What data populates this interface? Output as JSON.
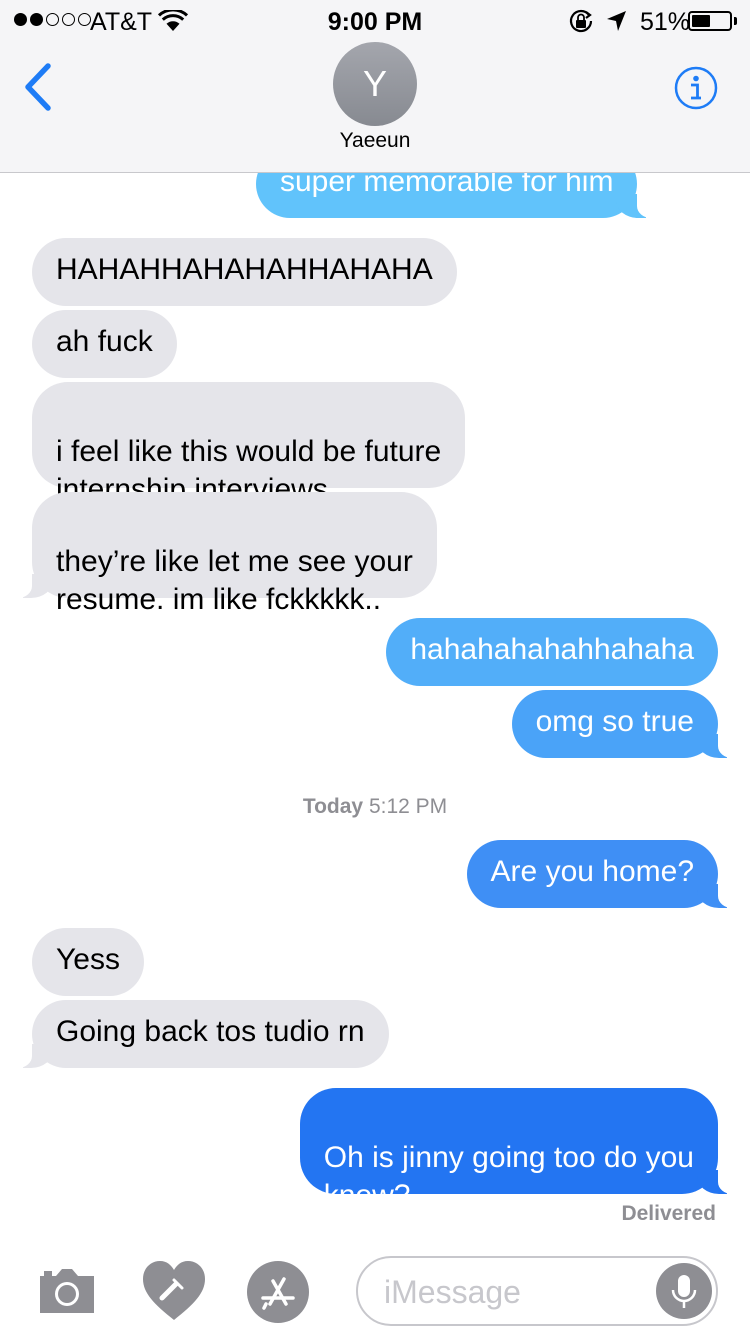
{
  "colors": {
    "incoming_bubble": "#e5e5ea",
    "outgoing_top": "#5ac0fb",
    "outgoing_bottom": "#1c6ff0",
    "ios_blue": "#1e7cf6",
    "secondary_text": "#8e8e93"
  },
  "status_bar": {
    "carrier": "AT&T",
    "time": "9:00 PM",
    "battery": "51%",
    "battery_level": 0.51,
    "signal_bars": 2,
    "icons": [
      "signal-dots-icon",
      "wifi-icon",
      "rotation-lock-icon",
      "location-arrow-icon",
      "battery-icon"
    ]
  },
  "nav": {
    "avatar_initial": "Y",
    "contact_name": "Yaeeun",
    "icons": [
      "chevron-left-icon",
      "info-icon"
    ]
  },
  "messages": [
    {
      "from": "me",
      "text": "super memorable for him"
    },
    {
      "from": "them",
      "text": "HAHAHHAHAHAHHAHAHA"
    },
    {
      "from": "them",
      "text": "ah fuck"
    },
    {
      "from": "them",
      "text": "i feel like this would be future\ninternship interviews"
    },
    {
      "from": "them",
      "text": "they’re like let me see your\nresume. im like fckkkkk.."
    },
    {
      "from": "me",
      "text": "hahahahahahhahaha"
    },
    {
      "from": "me",
      "text": "omg so true"
    },
    {
      "from": "me",
      "text": "Are you home?"
    },
    {
      "from": "them",
      "text": "Yess"
    },
    {
      "from": "them",
      "text": "Going back tos tudio rn"
    },
    {
      "from": "me",
      "text": "Oh is jinny going too do you\nknow?"
    }
  ],
  "timestamp": {
    "day": "Today",
    "time": "5:12 PM"
  },
  "delivered_label": "Delivered",
  "input": {
    "placeholder": "iMessage",
    "icons": [
      "camera-icon",
      "digital-touch-heart-icon",
      "app-store-icon",
      "microphone-icon"
    ]
  }
}
